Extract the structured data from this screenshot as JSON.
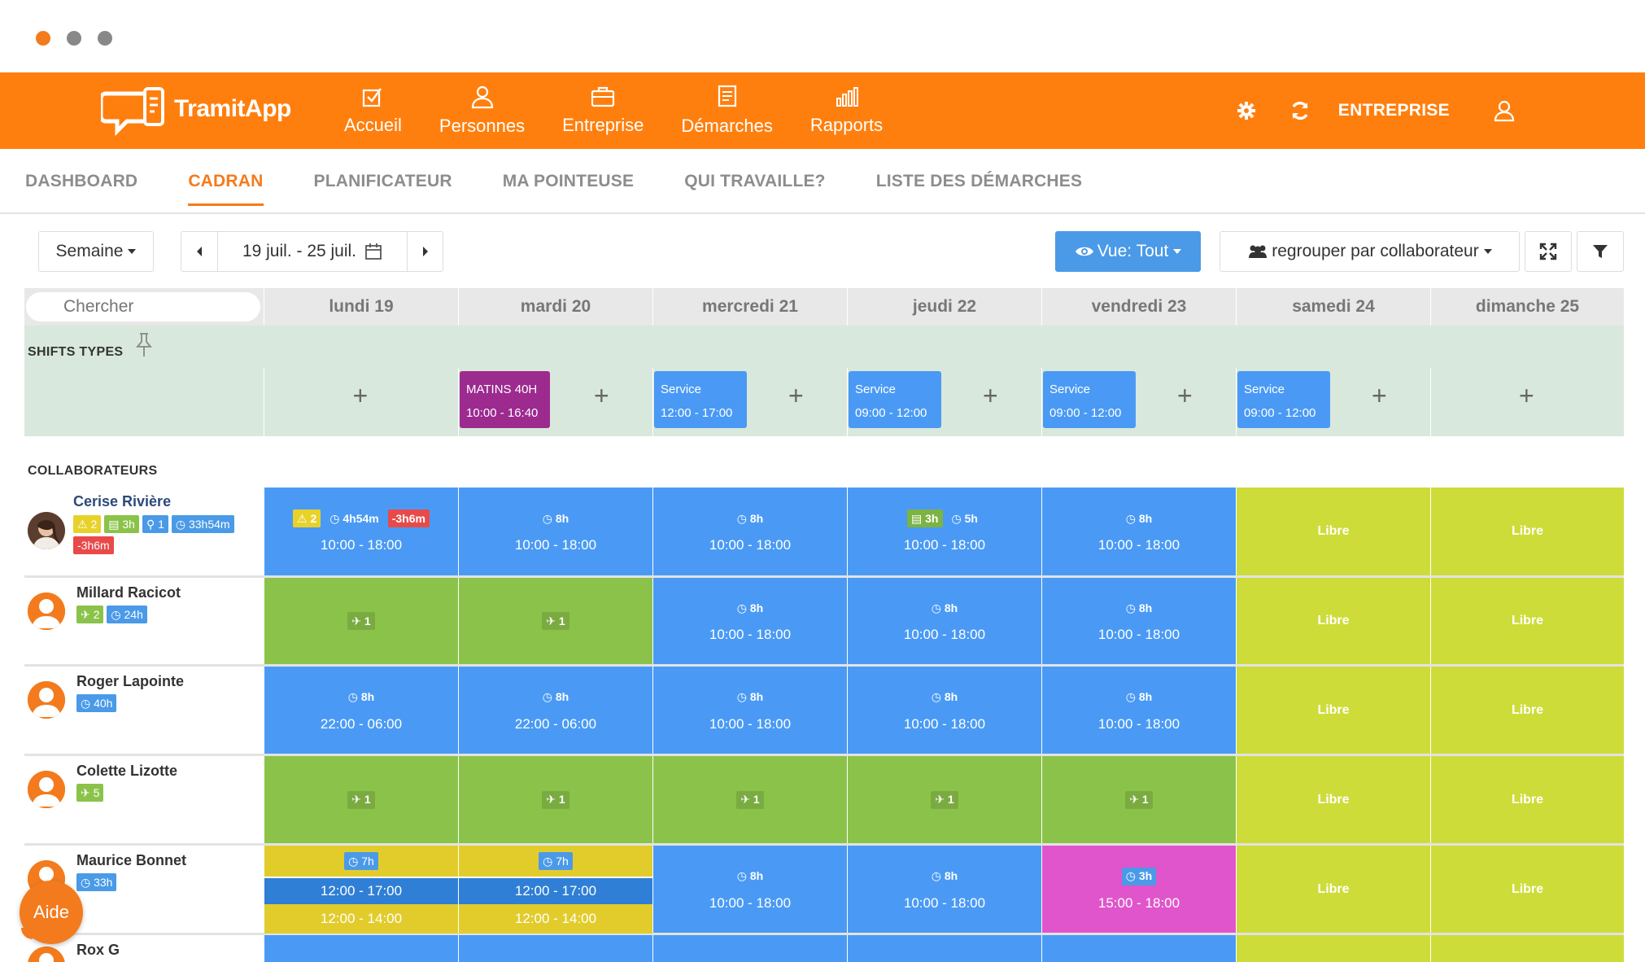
{
  "app": {
    "name": "TramitApp"
  },
  "nav": [
    {
      "label": "Accueil",
      "icon": "checkbox-icon"
    },
    {
      "label": "Personnes",
      "icon": "person-icon"
    },
    {
      "label": "Entreprise",
      "icon": "briefcase-icon"
    },
    {
      "label": "Démarches",
      "icon": "document-icon"
    },
    {
      "label": "Rapports",
      "icon": "bar-chart-icon"
    }
  ],
  "header": {
    "company": "ENTREPRISE"
  },
  "tabs": [
    "DASHBOARD",
    "CADRAN",
    "PLANIFICATEUR",
    "MA POINTEUSE",
    "QUI TRAVAILLE?",
    "LISTE DES DÉMARCHES"
  ],
  "active_tab": "CADRAN",
  "toolbar": {
    "period": "Semaine",
    "date_range": "19 juil. - 25 juil.",
    "view": "Vue: Tout",
    "group": "regrouper par collaborateur"
  },
  "search": {
    "placeholder": "Chercher"
  },
  "days": [
    "lundi 19",
    "mardi 20",
    "mercredi 21",
    "jeudi 22",
    "vendredi 23",
    "samedi 24",
    "dimanche 25"
  ],
  "shift_types": {
    "title": "SHIFTS TYPES",
    "chips": [
      {
        "day": 1,
        "name": "MATINS 40H",
        "time": "10:00 - 16:40",
        "color": "#9c2a8f"
      },
      {
        "day": 2,
        "name": "Service",
        "time": "12:00 - 17:00",
        "color": "#4a9af5"
      },
      {
        "day": 3,
        "name": "Service",
        "time": "09:00 - 12:00",
        "color": "#4a9af5"
      },
      {
        "day": 4,
        "name": "Service",
        "time": "09:00 - 12:00",
        "color": "#4a9af5"
      },
      {
        "day": 5,
        "name": "Service",
        "time": "09:00 - 12:00",
        "color": "#4a9af5"
      }
    ]
  },
  "collaborators_title": "COLLABORATEURS",
  "people": [
    {
      "name": "Cerise Rivière",
      "badges": [
        [
          "⚠ 2",
          "yellow"
        ],
        [
          "▤ 3h",
          "green"
        ],
        [
          "⚲ 1",
          "blue"
        ],
        [
          "◷ 33h54m",
          "blue"
        ],
        [
          "-3h6m",
          "red"
        ]
      ],
      "cells": [
        {
          "type": "shift",
          "color": "blue",
          "meta": [
            [
              "⚠ 2",
              "y"
            ],
            [
              "◷ 4h54m",
              ""
            ],
            [
              "-3h6m",
              "r"
            ]
          ],
          "time": "10:00 - 18:00"
        },
        {
          "type": "shift",
          "color": "blue",
          "meta": [
            [
              "◷ 8h",
              ""
            ]
          ],
          "time": "10:00 - 18:00"
        },
        {
          "type": "shift",
          "color": "blue",
          "meta": [
            [
              "◷ 8h",
              ""
            ]
          ],
          "time": "10:00 - 18:00"
        },
        {
          "type": "shift",
          "color": "blue",
          "meta": [
            [
              "▤ 3h",
              "g"
            ],
            [
              "◷ 5h",
              ""
            ]
          ],
          "time": "10:00 - 18:00"
        },
        {
          "type": "shift",
          "color": "blue",
          "meta": [
            [
              "◷ 8h",
              ""
            ]
          ],
          "time": "10:00 - 18:00"
        },
        {
          "type": "libre",
          "label": "Libre"
        },
        {
          "type": "libre",
          "label": "Libre"
        }
      ]
    },
    {
      "name": "Millard Racicot",
      "badges": [
        [
          "✈ 2",
          "green"
        ],
        [
          "◷ 24h",
          "blue"
        ]
      ],
      "cells": [
        {
          "type": "leave",
          "label": "✈ 1"
        },
        {
          "type": "leave",
          "label": "✈ 1"
        },
        {
          "type": "shift",
          "color": "blue",
          "meta": [
            [
              "◷ 8h",
              ""
            ]
          ],
          "time": "10:00 - 18:00"
        },
        {
          "type": "shift",
          "color": "blue",
          "meta": [
            [
              "◷ 8h",
              ""
            ]
          ],
          "time": "10:00 - 18:00"
        },
        {
          "type": "shift",
          "color": "blue",
          "meta": [
            [
              "◷ 8h",
              ""
            ]
          ],
          "time": "10:00 - 18:00"
        },
        {
          "type": "libre",
          "label": "Libre"
        },
        {
          "type": "libre",
          "label": "Libre"
        }
      ]
    },
    {
      "name": "Roger Lapointe",
      "badges": [
        [
          "◷ 40h",
          "blue"
        ]
      ],
      "cells": [
        {
          "type": "shift",
          "color": "blue",
          "meta": [
            [
              "◷ 8h",
              ""
            ]
          ],
          "time": "22:00 - 06:00"
        },
        {
          "type": "shift",
          "color": "blue",
          "meta": [
            [
              "◷ 8h",
              ""
            ]
          ],
          "time": "22:00 - 06:00"
        },
        {
          "type": "shift",
          "color": "blue",
          "meta": [
            [
              "◷ 8h",
              ""
            ]
          ],
          "time": "10:00 - 18:00"
        },
        {
          "type": "shift",
          "color": "blue",
          "meta": [
            [
              "◷ 8h",
              ""
            ]
          ],
          "time": "10:00 - 18:00"
        },
        {
          "type": "shift",
          "color": "blue",
          "meta": [
            [
              "◷ 8h",
              ""
            ]
          ],
          "time": "10:00 - 18:00"
        },
        {
          "type": "libre",
          "label": "Libre"
        },
        {
          "type": "libre",
          "label": "Libre"
        }
      ]
    },
    {
      "name": "Colette Lizotte",
      "badges": [
        [
          "✈ 5",
          "green"
        ]
      ],
      "cells": [
        {
          "type": "leave",
          "label": "✈ 1"
        },
        {
          "type": "leave",
          "label": "✈ 1"
        },
        {
          "type": "leave",
          "label": "✈ 1"
        },
        {
          "type": "leave",
          "label": "✈ 1"
        },
        {
          "type": "leave",
          "label": "✈ 1"
        },
        {
          "type": "libre",
          "label": "Libre"
        },
        {
          "type": "libre",
          "label": "Libre"
        }
      ]
    },
    {
      "name": "Maurice Bonnet",
      "badges": [
        [
          "◷ 33h",
          "blue"
        ]
      ],
      "cells": [
        {
          "type": "split",
          "meta": "◷ 7h",
          "mid": "12:00 - 17:00",
          "bot": "12:00 - 14:00"
        },
        {
          "type": "split",
          "meta": "◷ 7h",
          "mid": "12:00 - 17:00",
          "bot": "12:00 - 14:00"
        },
        {
          "type": "shift",
          "color": "blue",
          "meta": [
            [
              "◷ 8h",
              ""
            ]
          ],
          "time": "10:00 - 18:00"
        },
        {
          "type": "shift",
          "color": "blue",
          "meta": [
            [
              "◷ 8h",
              ""
            ]
          ],
          "time": "10:00 - 18:00"
        },
        {
          "type": "shift",
          "color": "pink",
          "meta": [
            [
              "◷ 3h",
              "b"
            ]
          ],
          "time": "15:00 - 18:00"
        },
        {
          "type": "libre",
          "label": "Libre"
        },
        {
          "type": "libre",
          "label": "Libre"
        }
      ]
    },
    {
      "name": "Rox G",
      "badges": [],
      "cells": [
        {
          "type": "shift",
          "color": "blue",
          "meta": [],
          "time": ""
        },
        {
          "type": "shift",
          "color": "blue",
          "meta": [],
          "time": ""
        },
        {
          "type": "shift",
          "color": "blue",
          "meta": [],
          "time": ""
        },
        {
          "type": "shift",
          "color": "blue",
          "meta": [],
          "time": ""
        },
        {
          "type": "shift",
          "color": "blue",
          "meta": [],
          "time": ""
        },
        {
          "type": "libre",
          "label": ""
        },
        {
          "type": "libre",
          "label": ""
        }
      ]
    }
  ],
  "help": {
    "label": "Aide"
  },
  "colors": {
    "brand": "#ff7f0e",
    "shift": "#4a9af5",
    "leave": "#8bc34a",
    "libre": "#cddc39"
  }
}
